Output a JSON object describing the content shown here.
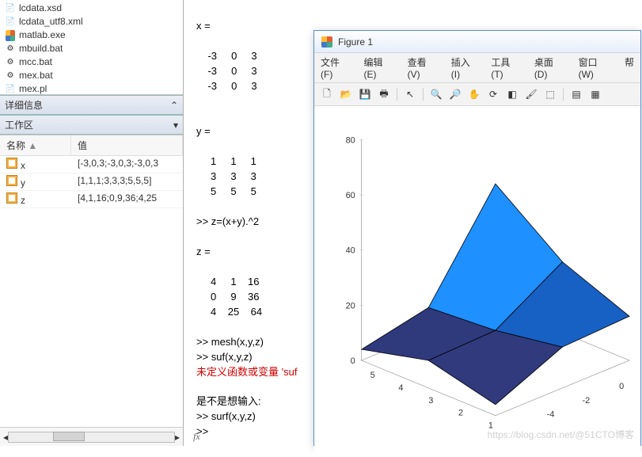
{
  "file_browser": {
    "items": [
      {
        "name": "lcdata.xsd",
        "icon": "xml-icon"
      },
      {
        "name": "lcdata_utf8.xml",
        "icon": "xml-icon"
      },
      {
        "name": "matlab.exe",
        "icon": "matlab-exe-icon"
      },
      {
        "name": "mbuild.bat",
        "icon": "bat-icon"
      },
      {
        "name": "mcc.bat",
        "icon": "bat-icon"
      },
      {
        "name": "mex.bat",
        "icon": "bat-icon"
      },
      {
        "name": "mex.pl",
        "icon": "file-icon"
      }
    ]
  },
  "details_panel": {
    "title": "详细信息"
  },
  "workspace": {
    "title": "工作区",
    "cols": {
      "name": "名称",
      "value": "值"
    },
    "vars": [
      {
        "name": "x",
        "value": "[-3,0,3;-3,0,3;-3,0,3"
      },
      {
        "name": "y",
        "value": "[1,1,1;3,3,3;5,5,5]"
      },
      {
        "name": "z",
        "value": "[4,1,16;0,9,36;4,25"
      }
    ]
  },
  "command_window": {
    "lines": [
      "x =",
      "",
      "    -3     0     3",
      "    -3     0     3",
      "    -3     0     3",
      "",
      "",
      "y =",
      "",
      "     1     1     1",
      "     3     3     3",
      "     5     5     5",
      "",
      ">> z=(x+y).^2",
      "",
      "z =",
      "",
      "     4     1    16",
      "     0     9    36",
      "     4    25    64",
      "",
      ">> mesh(x,y,z)",
      ">> suf(x,y,z)"
    ],
    "error": "未定义函数或变量 'suf",
    "suggest_label": "是不是想输入:",
    "suggest": ">> surf(x,y,z)",
    "prompt": ">>",
    "fx": "fx"
  },
  "figure": {
    "title": "Figure 1",
    "menu": [
      "文件(F)",
      "编辑(E)",
      "查看(V)",
      "插入(I)",
      "工具(T)",
      "桌面(D)",
      "窗口(W)",
      "帮"
    ],
    "toolbar_icons": [
      "new",
      "open",
      "save",
      "print",
      "arrow",
      "zoom-in",
      "zoom-out",
      "pan",
      "rotate3d",
      "datatip",
      "brush",
      "link",
      "colorbar",
      "legend"
    ]
  },
  "chart_data": {
    "type": "surface",
    "title": "",
    "x": [
      -3,
      0,
      3
    ],
    "y": [
      1,
      3,
      5
    ],
    "z": [
      [
        4,
        1,
        16
      ],
      [
        0,
        9,
        36
      ],
      [
        4,
        25,
        64
      ]
    ],
    "xlabel": "",
    "ylabel": "",
    "zlabel": "",
    "x_ticks_visible": [
      -4,
      -2,
      0
    ],
    "y_ticks_visible": [
      1,
      2,
      3,
      4,
      5
    ],
    "z_ticks_visible": [
      0,
      20,
      40,
      60,
      80
    ],
    "zlim": [
      0,
      80
    ],
    "xlim": [
      -3,
      3
    ],
    "ylim": [
      1,
      5
    ],
    "colors": {
      "low": "#2f3a7d",
      "mid": "#1760c4",
      "high": "#1e90ff"
    }
  },
  "watermark": "https://blog.csdn.net/@51CTO博客"
}
